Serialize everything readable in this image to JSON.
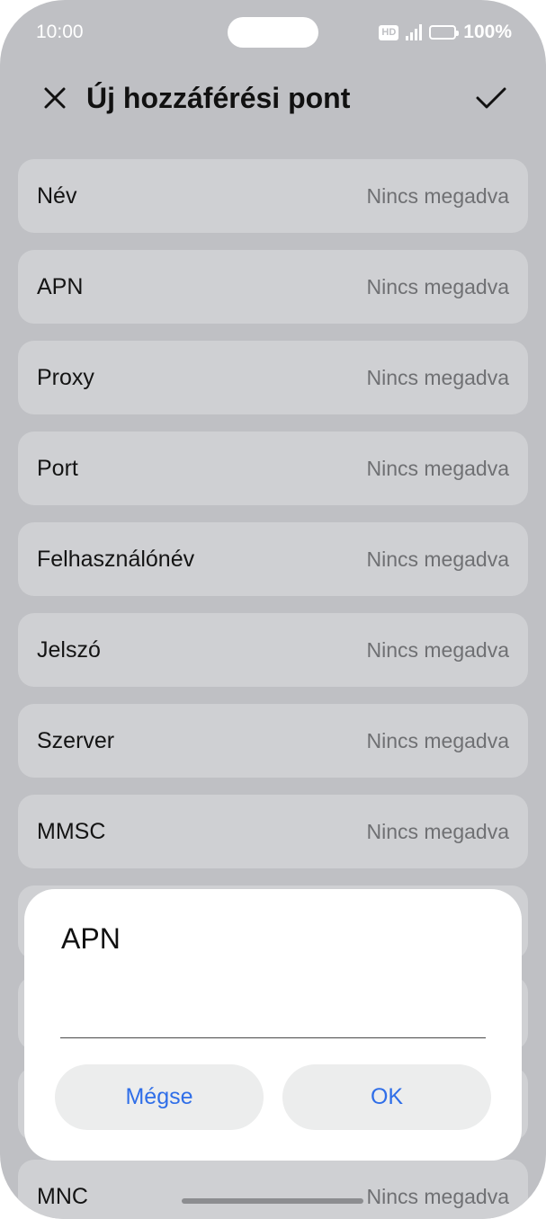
{
  "status_bar": {
    "time": "10:00",
    "hd_label": "HD",
    "battery_percent": "100%",
    "signal_level": 4
  },
  "header": {
    "title": "Új hozzáférési pont",
    "close_icon": "close-icon",
    "confirm_icon": "check-icon"
  },
  "rows": [
    {
      "label": "Név",
      "value": "Nincs megadva"
    },
    {
      "label": "APN",
      "value": "Nincs megadva"
    },
    {
      "label": "Proxy",
      "value": "Nincs megadva"
    },
    {
      "label": "Port",
      "value": "Nincs megadva"
    },
    {
      "label": "Felhasználónév",
      "value": "Nincs megadva"
    },
    {
      "label": "Jelszó",
      "value": "Nincs megadva"
    },
    {
      "label": "Szerver",
      "value": "Nincs megadva"
    },
    {
      "label": "MMSC",
      "value": "Nincs megadva"
    },
    {
      "label": "",
      "value": ""
    },
    {
      "label": "",
      "value": ""
    },
    {
      "label": "",
      "value": ""
    },
    {
      "label": "MNC",
      "value": "Nincs megadva"
    }
  ],
  "dialog": {
    "title": "APN",
    "input_value": "",
    "cancel_label": "Mégse",
    "ok_label": "OK"
  },
  "colors": {
    "background": "#bfc0c4",
    "row_background": "#cfd0d3",
    "accent": "#2f6ee8"
  }
}
